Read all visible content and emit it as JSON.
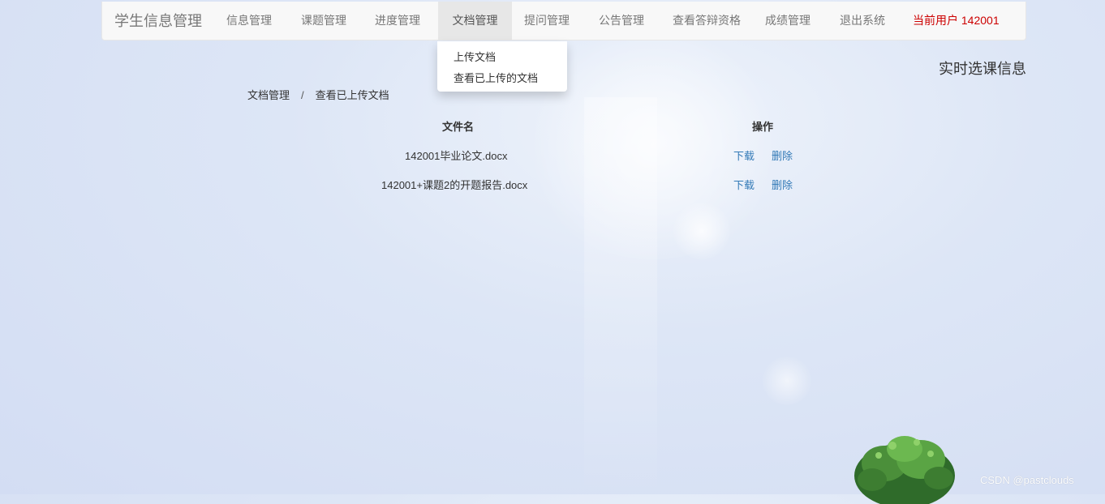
{
  "nav": {
    "brand": "学生信息管理",
    "items": [
      "信息管理",
      "课题管理",
      "进度管理",
      "文档管理",
      "提问管理",
      "公告管理",
      "查看答辩资格",
      "成绩管理",
      "退出系统"
    ],
    "active_index": 3,
    "user": "当前用户  142001"
  },
  "dropdown": {
    "items": [
      "上传文档",
      "查看已上传的文档"
    ]
  },
  "side_title": "实时选课信息",
  "breadcrumb": {
    "items": [
      "文档管理",
      "查看已上传文档"
    ],
    "separator": "/"
  },
  "table": {
    "headers": [
      "文件名",
      "操作"
    ],
    "rows": [
      {
        "filename": "142001毕业论文.docx",
        "actions": [
          "下载",
          "删除"
        ]
      },
      {
        "filename": "142001+课题2的开题报告.docx",
        "actions": [
          "下载",
          "删除"
        ]
      }
    ]
  },
  "watermark": "CSDN @pastclouds",
  "colors": {
    "link": "#337ab7",
    "user": "#cc0000",
    "navbar_bg": "#f8f8f8",
    "active_tab_bg": "#e7e7e7"
  }
}
